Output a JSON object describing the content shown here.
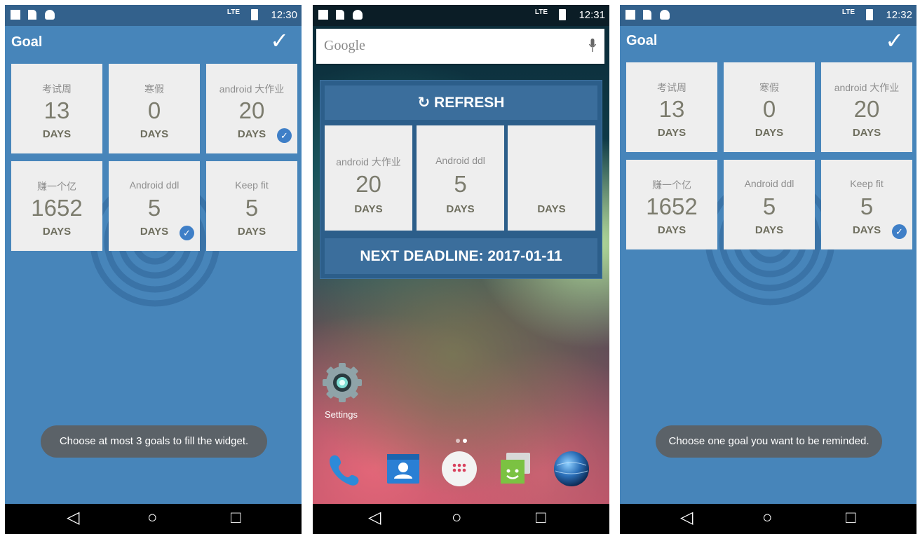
{
  "screens": {
    "goal_select": {
      "status": {
        "time": "12:30",
        "network": "LTE"
      },
      "appbar": {
        "title": "Goal",
        "confirm_icon": "check-icon"
      },
      "goals": [
        {
          "name": "考试周",
          "days": "13",
          "unit": "DAYS",
          "selected": false
        },
        {
          "name": "寒假",
          "days": "0",
          "unit": "DAYS",
          "selected": false
        },
        {
          "name": "android 大作业",
          "days": "20",
          "unit": "DAYS",
          "selected": true
        },
        {
          "name": "赚一个亿",
          "days": "1652",
          "unit": "DAYS",
          "selected": false
        },
        {
          "name": "Android ddl",
          "days": "5",
          "unit": "DAYS",
          "selected": true
        },
        {
          "name": "Keep fit",
          "days": "5",
          "unit": "DAYS",
          "selected": false
        }
      ],
      "toast": "Choose at most 3 goals to fill the widget."
    },
    "home_widget": {
      "status": {
        "time": "12:31",
        "network": "LTE"
      },
      "search": {
        "logo_text": "Google",
        "mic_icon": "mic-icon"
      },
      "widget": {
        "refresh_label": "REFRESH",
        "refresh_icon": "refresh-icon",
        "goals": [
          {
            "name": "android 大作业",
            "days": "20",
            "unit": "DAYS"
          },
          {
            "name": "Android ddl",
            "days": "5",
            "unit": "DAYS"
          },
          {
            "name": "",
            "days": "",
            "unit": "DAYS"
          }
        ],
        "deadline_label": "NEXT DEADLINE: 2017-01-11"
      },
      "desktop": {
        "settings_label": "Settings"
      },
      "dock_icons": [
        "phone-icon",
        "contacts-icon",
        "app-drawer-icon",
        "messaging-icon",
        "browser-icon"
      ]
    },
    "goal_remind": {
      "status": {
        "time": "12:32",
        "network": "LTE"
      },
      "appbar": {
        "title": "Goal",
        "confirm_icon": "check-icon"
      },
      "goals": [
        {
          "name": "考试周",
          "days": "13",
          "unit": "DAYS",
          "selected": false
        },
        {
          "name": "寒假",
          "days": "0",
          "unit": "DAYS",
          "selected": false
        },
        {
          "name": "android 大作业",
          "days": "20",
          "unit": "DAYS",
          "selected": false
        },
        {
          "name": "赚一个亿",
          "days": "1652",
          "unit": "DAYS",
          "selected": false
        },
        {
          "name": "Android ddl",
          "days": "5",
          "unit": "DAYS",
          "selected": false
        },
        {
          "name": "Keep fit",
          "days": "5",
          "unit": "DAYS",
          "selected": true
        }
      ],
      "toast": "Choose one goal you want to be reminded."
    }
  },
  "colors": {
    "primary": "#4785ba",
    "status_bar": "#33618c",
    "tile": "#eeeeee",
    "selected_check": "#3f7fc7",
    "widget_bg": "#2c5e8a",
    "widget_bar": "#3b6e9c"
  }
}
